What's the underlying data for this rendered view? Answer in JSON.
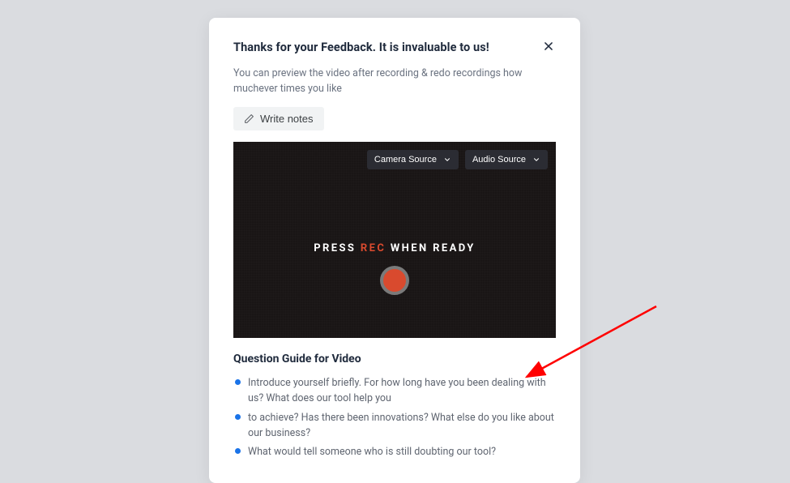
{
  "modal": {
    "title": "Thanks for your Feedback. It is invaluable to us!",
    "subtitle": "You can preview the video after recording & redo recordings how muchever times you like",
    "write_notes_label": "Write notes"
  },
  "video": {
    "camera_source_label": "Camera Source",
    "audio_source_label": "Audio Source",
    "press_label": "PRESS ",
    "rec_label": "REC",
    "ready_label": " WHEN READY"
  },
  "guide": {
    "title": "Question Guide for Video",
    "items": [
      "Introduce yourself briefly.\nFor how long have you been dealing with us? What does our tool help you",
      "to achieve? Has there been innovations? What else do you like about our business?",
      "What would tell someone who is still doubting our tool?"
    ]
  }
}
